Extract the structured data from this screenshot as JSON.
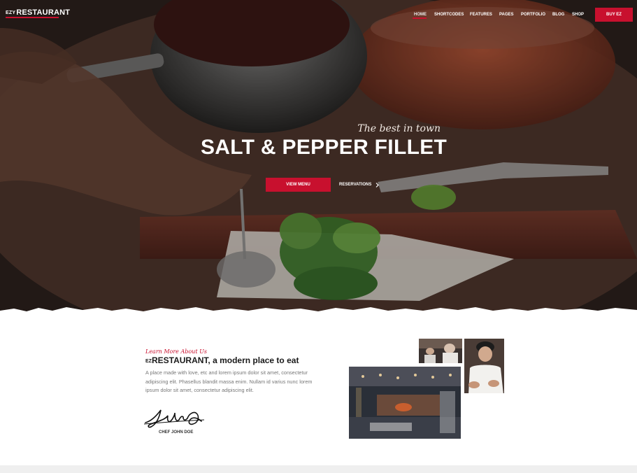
{
  "brand": {
    "ez": "EZY",
    "name": "RESTAURANT",
    "accent": "#c8102e"
  },
  "nav": {
    "items": [
      {
        "label": "HOME",
        "active": true
      },
      {
        "label": "SHORTCODES"
      },
      {
        "label": "FEATURES"
      },
      {
        "label": "PAGES"
      },
      {
        "label": "PORTFOLIO"
      },
      {
        "label": "BLOG"
      },
      {
        "label": "SHOP"
      }
    ],
    "cta": "BUY EZ"
  },
  "hero": {
    "tagline": "The best in town",
    "title": "SALT & PEPPER FILLET",
    "primary_button": "VIEW MENU",
    "secondary_button": "RESERVATIONS",
    "secondary_icon": "chevron-right-icon"
  },
  "about": {
    "kicker": "Learn More About Us",
    "title_ez": "EZ",
    "title_rest": "RESTAURANT, a modern place to eat",
    "text": "A place made with love, etc and lorem ipsum dolor sit amet, consectetur adipiscing elit. Phasellus blandit massa enim. Nullam id varius nunc lorem ipsum dolor sit amet, consectetur adipiscing elit.",
    "signature": "JohnDoe",
    "chef": "CHEF JOHN DOE"
  }
}
